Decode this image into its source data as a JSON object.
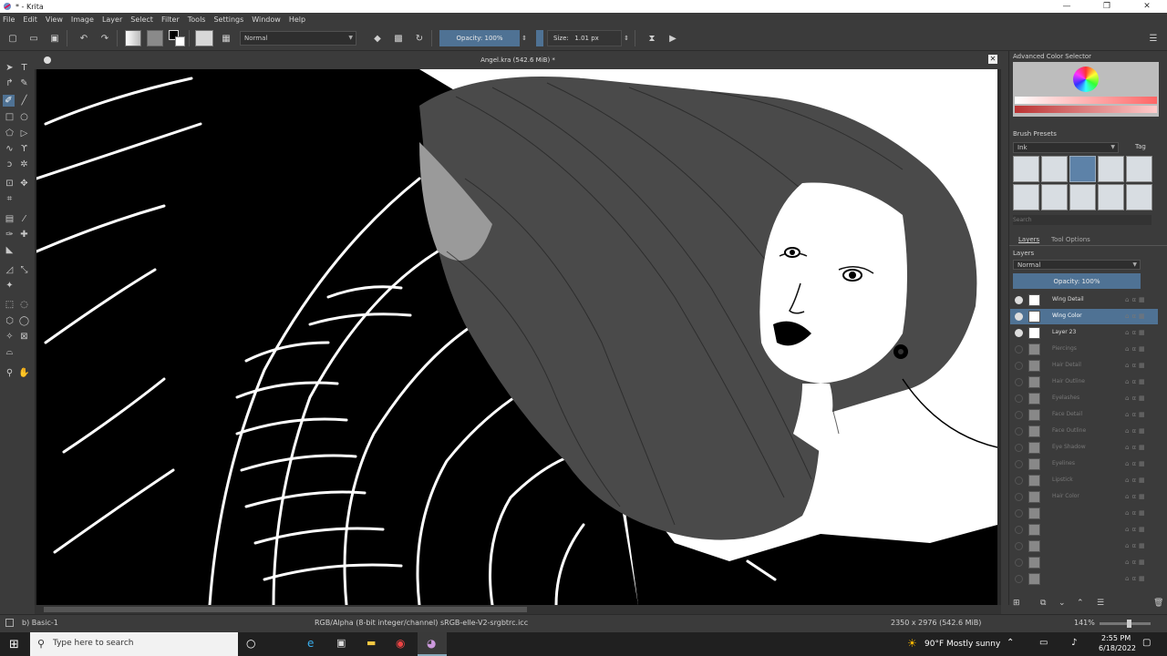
{
  "window": {
    "title": "* - Krita",
    "minimize": "—",
    "maximize": "❐",
    "close": "✕"
  },
  "menu": [
    "File",
    "Edit",
    "View",
    "Image",
    "Layer",
    "Select",
    "Filter",
    "Tools",
    "Settings",
    "Window",
    "Help"
  ],
  "toolbar": {
    "blend_mode": "Normal",
    "opacity_label": "Opacity:",
    "opacity_value": "100%",
    "size_label": "Size:",
    "size_value": "1.01 px"
  },
  "document": {
    "tab_title": "Angel.kra (542.6 MiB) *"
  },
  "docker": {
    "color_selector_title": "Advanced Color Selector",
    "brush_presets_title": "Brush Presets",
    "brush_tag": "Ink",
    "tag_button": "Tag",
    "search_placeholder": "Search",
    "tabs": [
      "Layers",
      "Tool Options"
    ],
    "layers_title": "Layers",
    "layer_blend": "Normal",
    "layer_opacity": "Opacity: 100%",
    "layers": [
      {
        "name": "Wing Detail",
        "visible": true,
        "selected": false
      },
      {
        "name": "Wing Color",
        "visible": true,
        "selected": true
      },
      {
        "name": "Layer 23",
        "visible": true,
        "selected": false
      },
      {
        "name": "Piercings",
        "visible": false,
        "selected": false
      },
      {
        "name": "Hair Detail",
        "visible": false,
        "selected": false
      },
      {
        "name": "Hair Outline",
        "visible": false,
        "selected": false
      },
      {
        "name": "Eyelashes",
        "visible": false,
        "selected": false
      },
      {
        "name": "Face Detail",
        "visible": false,
        "selected": false
      },
      {
        "name": "Face Outline",
        "visible": false,
        "selected": false
      },
      {
        "name": "Eye Shadow",
        "visible": false,
        "selected": false
      },
      {
        "name": "Eyelines",
        "visible": false,
        "selected": false
      },
      {
        "name": "Lipstick",
        "visible": false,
        "selected": false
      },
      {
        "name": "Hair Color",
        "visible": false,
        "selected": false
      },
      {
        "name": "",
        "visible": false,
        "selected": false
      },
      {
        "name": "",
        "visible": false,
        "selected": false
      },
      {
        "name": "",
        "visible": false,
        "selected": false
      },
      {
        "name": "",
        "visible": false,
        "selected": false
      },
      {
        "name": "",
        "visible": false,
        "selected": false
      }
    ]
  },
  "status": {
    "brush": "b) Basic-1",
    "color_space": "RGB/Alpha (8-bit integer/channel)  sRGB-elle-V2-srgbtrc.icc",
    "dimensions": "2350 x 2976 (542.6 MiB)",
    "zoom": "141%"
  },
  "taskbar": {
    "search_placeholder": "Type here to search",
    "weather": "90°F  Mostly sunny",
    "time": "2:55 PM",
    "date": "6/18/2022"
  },
  "colors": {
    "accent": "#4f7294",
    "panel": "#3b3b3b",
    "selected_layer": "#4f7294"
  }
}
